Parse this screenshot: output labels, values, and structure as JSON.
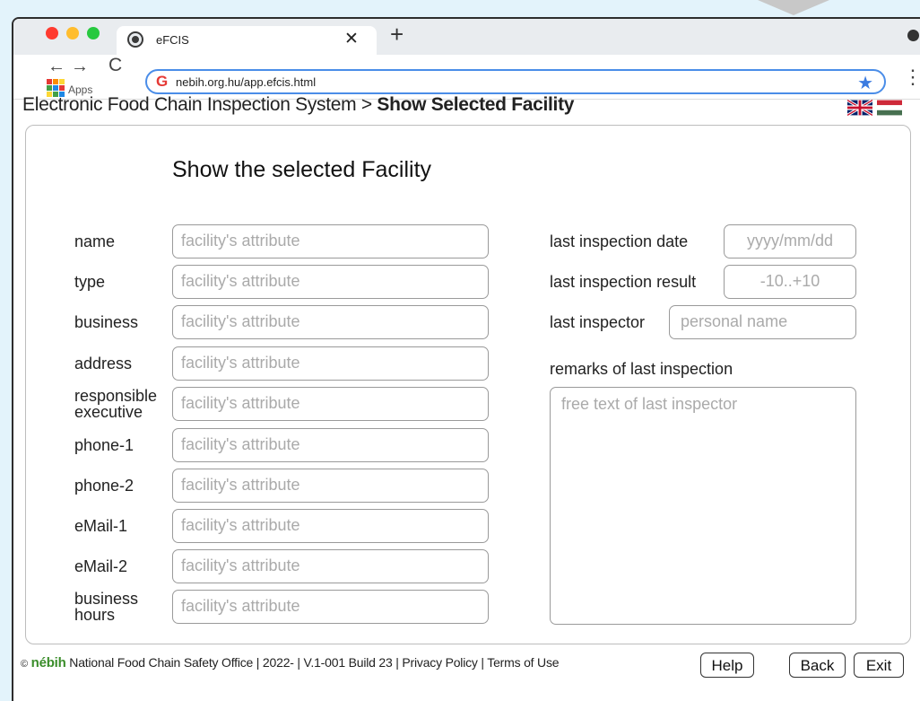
{
  "browser": {
    "tab_title": "eFCIS",
    "tab_close": "✕",
    "new_tab": "+",
    "back": "←",
    "forward": "→",
    "reload": "C",
    "apps_label": "Apps",
    "url": "nebih.org.hu/app.efcis.html",
    "bookmark_star": "★",
    "menu": "⋮",
    "traffic_colors": [
      "#ff3b30",
      "#ffbd2e",
      "#27c93f"
    ]
  },
  "header": {
    "breadcrumb_root": "Electronic Food Chain Inspection System > ",
    "breadcrumb_current": "Show Selected Facility"
  },
  "form": {
    "heading": "Show the selected Facility",
    "left_fields": [
      {
        "label": "name",
        "placeholder": "facility's attribute"
      },
      {
        "label": "type",
        "placeholder": "facility's attribute"
      },
      {
        "label": "business",
        "placeholder": "facility's attribute"
      },
      {
        "label": "address",
        "placeholder": "facility's attribute"
      },
      {
        "label": "responsible executive",
        "placeholder": "facility's attribute"
      },
      {
        "label": "phone-1",
        "placeholder": "facility's attribute"
      },
      {
        "label": "phone-2",
        "placeholder": "facility's attribute"
      },
      {
        "label": "eMail-1",
        "placeholder": "facility's attribute"
      },
      {
        "label": "eMail-2",
        "placeholder": "facility's attribute"
      },
      {
        "label": "business hours",
        "placeholder": "facility's attribute"
      }
    ],
    "last_inspection_date": {
      "label": "last inspection date",
      "placeholder": "yyyy/mm/dd"
    },
    "last_inspection_result": {
      "label": "last inspection result",
      "placeholder": "-10..+10"
    },
    "last_inspector": {
      "label": "last inspector",
      "placeholder": "personal name"
    },
    "remarks": {
      "label": "remarks of last inspection",
      "placeholder": "free text of last inspector"
    }
  },
  "footer": {
    "copyright": "©",
    "logo": "nébih",
    "text": " National Food Chain Safety Office  |  2022-  |  V.1-001 Build 23  |  Privacy Policy  |  Terms of Use",
    "help_label": "Help",
    "back_label": "Back",
    "exit_label": "Exit"
  }
}
